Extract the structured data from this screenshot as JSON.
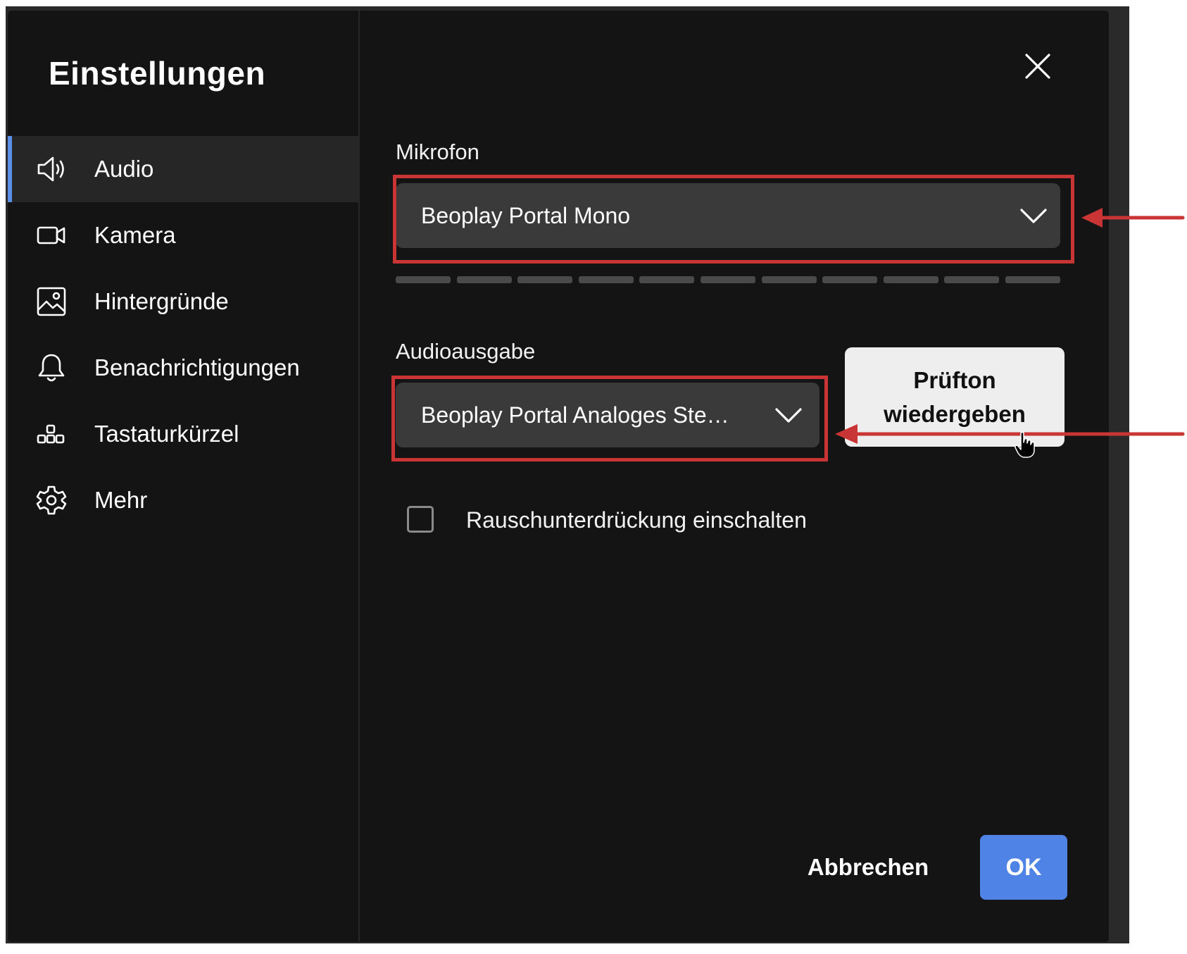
{
  "dialog": {
    "title": "Einstellungen",
    "close_icon": "close-icon"
  },
  "sidebar": {
    "items": [
      {
        "label": "Audio",
        "icon": "speaker-icon",
        "active": true
      },
      {
        "label": "Kamera",
        "icon": "camera-icon",
        "active": false
      },
      {
        "label": "Hintergründe",
        "icon": "image-icon",
        "active": false
      },
      {
        "label": "Benachrichtigungen",
        "icon": "bell-icon",
        "active": false
      },
      {
        "label": "Tastaturkürzel",
        "icon": "keyboard-shortcut-icon",
        "active": false
      },
      {
        "label": "Mehr",
        "icon": "gear-icon",
        "active": false
      }
    ]
  },
  "audio": {
    "microphone_label": "Mikrofon",
    "microphone_value": "Beoplay Portal Mono",
    "output_label": "Audioausgabe",
    "output_value": "Beoplay Portal Analoges Ste…",
    "test_button": "Prüfton wiedergeben",
    "noise_suppression_label": "Rauschunterdrückung einschalten",
    "noise_suppression_checked": false
  },
  "footer": {
    "cancel_label": "Abbrechen",
    "ok_label": "OK"
  },
  "colors": {
    "background": "#141414",
    "active_item": "#262626",
    "accent": "#4f84e6",
    "select_bg": "#3a3a3a",
    "annotation": "#c93535"
  }
}
